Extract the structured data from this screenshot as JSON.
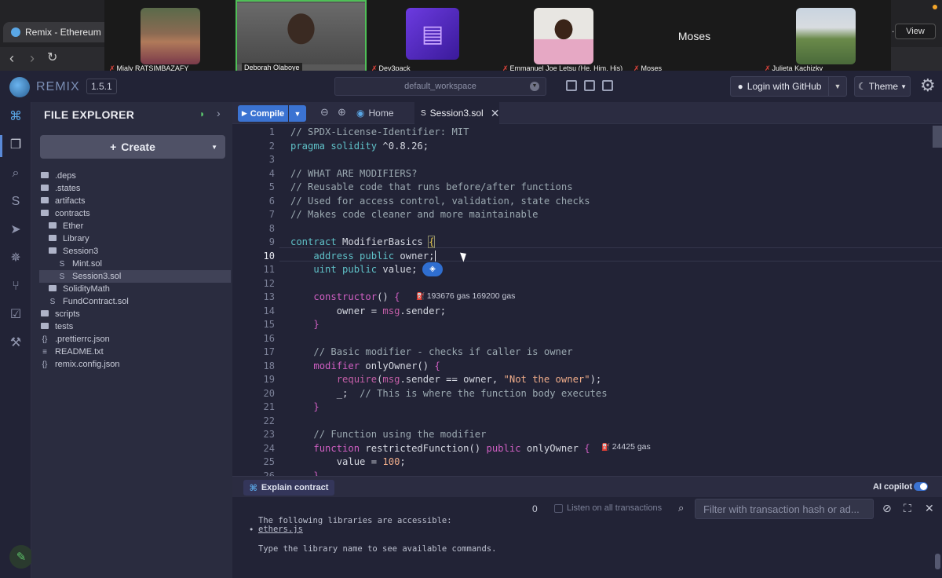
{
  "browser": {
    "tab_title": "Remix - Ethereum IDE",
    "view_button": "View",
    "right_tab_fragment": "..."
  },
  "participants": [
    {
      "name": "Mialy RATSIMBAZAFY",
      "muted": true
    },
    {
      "name": "Deborah Olaboye",
      "muted": false,
      "active_speaker": true
    },
    {
      "name": "Dev3pack",
      "muted": true
    },
    {
      "name": "Emmanuel Joe Letsu (He, Him, His)",
      "muted": true
    },
    {
      "name": "Moses",
      "muted": true,
      "display_text": "Moses"
    },
    {
      "name": "Julieta Kachizky",
      "muted": true
    }
  ],
  "remix": {
    "logo_text": "REMIX",
    "version": "1.5.1",
    "workspace": "default_workspace",
    "login_label": "Login with GitHub",
    "theme_label": "Theme"
  },
  "file_explorer": {
    "title": "FILE EXPLORER",
    "create_label": "Create",
    "tree": [
      {
        "name": ".deps",
        "type": "folder",
        "depth": 0
      },
      {
        "name": ".states",
        "type": "folder",
        "depth": 0
      },
      {
        "name": "artifacts",
        "type": "folder",
        "depth": 0
      },
      {
        "name": "contracts",
        "type": "folder-open",
        "depth": 0
      },
      {
        "name": "Ether",
        "type": "folder",
        "depth": 1
      },
      {
        "name": "Library",
        "type": "folder",
        "depth": 1
      },
      {
        "name": "Session3",
        "type": "folder-open",
        "depth": 1
      },
      {
        "name": "Mint.sol",
        "type": "sol",
        "depth": 2
      },
      {
        "name": "Session3.sol",
        "type": "sol",
        "depth": 2,
        "selected": true
      },
      {
        "name": "SolidityMath",
        "type": "folder",
        "depth": 1
      },
      {
        "name": "FundContract.sol",
        "type": "sol",
        "depth": 1
      },
      {
        "name": "scripts",
        "type": "folder",
        "depth": 0
      },
      {
        "name": "tests",
        "type": "folder",
        "depth": 0
      },
      {
        "name": ".prettierrc.json",
        "type": "json",
        "depth": 0
      },
      {
        "name": "README.txt",
        "type": "txt",
        "depth": 0
      },
      {
        "name": "remix.config.json",
        "type": "json",
        "depth": 0
      }
    ]
  },
  "editor": {
    "compile_label": "Compile",
    "home_tab": "Home",
    "active_tab": "Session3.sol",
    "current_line": 10,
    "lines": [
      [
        [
          "cm",
          "// SPDX-License-Identifier: MIT"
        ]
      ],
      [
        [
          "kw",
          "pragma solidity"
        ],
        [
          "tx",
          " ^0.8.26;"
        ]
      ],
      [],
      [
        [
          "cm",
          "// WHAT ARE MODIFIERS?"
        ]
      ],
      [
        [
          "cm",
          "// Reusable code that runs before/after functions"
        ]
      ],
      [
        [
          "cm",
          "// Used for access control, validation, state checks"
        ]
      ],
      [
        [
          "cm",
          "// Makes code cleaner and more maintainable"
        ]
      ],
      [],
      [
        [
          "kw",
          "contract"
        ],
        [
          "tx",
          " ModifierBasics "
        ],
        [
          "br",
          "{"
        ]
      ],
      [
        [
          "tx",
          "    "
        ],
        [
          "kw",
          "address public"
        ],
        [
          "tx",
          " owner;"
        ]
      ],
      [
        [
          "tx",
          "    "
        ],
        [
          "kw",
          "uint public"
        ],
        [
          "tx",
          " value;"
        ]
      ],
      [],
      [
        [
          "tx",
          "    "
        ],
        [
          "kw2",
          "constructor"
        ],
        [
          "tx",
          "() "
        ],
        [
          "kw2",
          "{"
        ]
      ],
      [
        [
          "tx",
          "        owner = "
        ],
        [
          "gl",
          "msg"
        ],
        [
          "tx",
          ".sender;"
        ]
      ],
      [
        [
          "tx",
          "    "
        ],
        [
          "kw2",
          "}"
        ]
      ],
      [],
      [
        [
          "tx",
          "    "
        ],
        [
          "cm",
          "// Basic modifier - checks if caller is owner"
        ]
      ],
      [
        [
          "tx",
          "    "
        ],
        [
          "kw2",
          "modifier"
        ],
        [
          "tx",
          " onlyOwner() "
        ],
        [
          "kw2",
          "{"
        ]
      ],
      [
        [
          "tx",
          "        "
        ],
        [
          "gl",
          "require"
        ],
        [
          "tx",
          "("
        ],
        [
          "gl",
          "msg"
        ],
        [
          "tx",
          ".sender == owner, "
        ],
        [
          "st",
          "\"Not the owner\""
        ],
        [
          "tx",
          ");"
        ]
      ],
      [
        [
          "tx",
          "        _;  "
        ],
        [
          "cm",
          "// This is where the function body executes"
        ]
      ],
      [
        [
          "tx",
          "    "
        ],
        [
          "kw2",
          "}"
        ]
      ],
      [],
      [
        [
          "tx",
          "    "
        ],
        [
          "cm",
          "// Function using the modifier"
        ]
      ],
      [
        [
          "tx",
          "    "
        ],
        [
          "kw2",
          "function"
        ],
        [
          "tx",
          " restrictedFunction() "
        ],
        [
          "kw2",
          "public"
        ],
        [
          "tx",
          " onlyOwner "
        ],
        [
          "kw2",
          "{"
        ]
      ],
      [
        [
          "tx",
          "        value = "
        ],
        [
          "nm",
          "100"
        ],
        [
          "tx",
          ";"
        ]
      ],
      [
        [
          "tx",
          "    "
        ],
        [
          "kw2",
          "}"
        ]
      ]
    ],
    "gas_constructor": "193676 gas 169200 gas",
    "gas_function": "24425 gas"
  },
  "terminal": {
    "explain_label": "Explain contract",
    "copilot_label": "AI copilot",
    "copilot_on": true,
    "tx_count": "0",
    "listen_label": "Listen on all transactions",
    "filter_placeholder": "Filter with transaction hash or ad...",
    "line_libs": "The following libraries are accessible:",
    "line_ethers": "ethers.js",
    "line_hint": "Type the library name to see available commands."
  },
  "colors": {
    "comment": "#9aa8b0",
    "keyword": "#5fc1c8",
    "keyword2": "#d05fc3",
    "global": "#c55fa8",
    "string": "#f1ad8a",
    "number": "#f1ad8a",
    "bracket": "#e6c84a",
    "text": "#d4d7e0",
    "accent": "#3b73d2"
  }
}
